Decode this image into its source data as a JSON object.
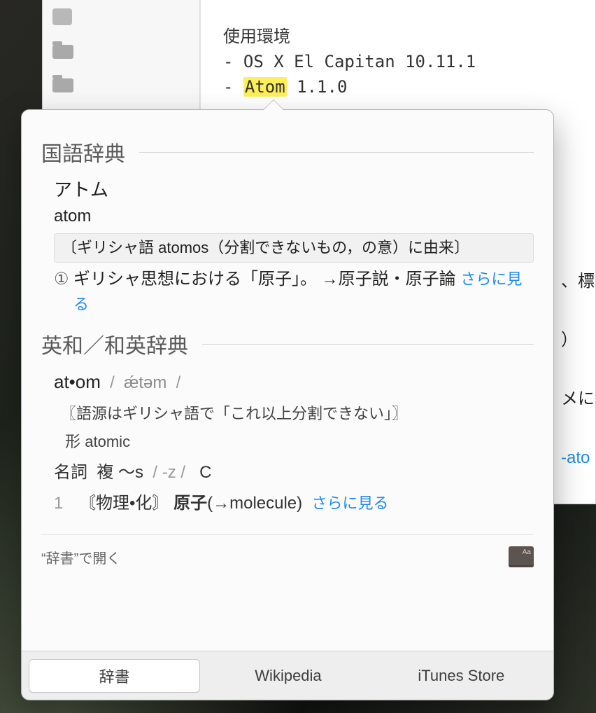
{
  "editor": {
    "heading": "使用環境",
    "line1_prefix": "- ",
    "line1_text": "OS X El Capitan 10.11.1",
    "line2_prefix": "- ",
    "highlighted_word": "Atom",
    "line2_suffix": " 1.1.0"
  },
  "popover": {
    "kokugo": {
      "title": "国語辞典",
      "term_kana": "アトム",
      "term_romaji": "atom",
      "etymology": "〔ギリシャ語 atomos（分割できないもの，の意）に由来〕",
      "sense_num": "①",
      "sense_text": "ギリシャ思想における「原子」。 →原子説・原子論",
      "see_more": "さらに見る"
    },
    "eiwa": {
      "title": "英和／和英辞典",
      "headword": "at•om",
      "pron": "ǽtəm",
      "etymology": "〖語源はギリシャ語で「これ以上分割できない」〗",
      "deriv_label": "形",
      "deriv_word": "atomic",
      "pos": "名詞",
      "plural_label": "複 〜s",
      "plural_pron": "-z",
      "count": "C",
      "sense_num": "1",
      "sense_field": "〘物理•化〙",
      "sense_bold": "原子",
      "sense_tail": "(→molecule)",
      "see_more": "さらに見る"
    },
    "open_label": "“辞書”で開く",
    "dict_icon_text": "Aa",
    "tabs": {
      "dict": "辞書",
      "wiki": "Wikipedia",
      "itunes": "iTunes Store"
    }
  },
  "right_peek": {
    "a": "、標",
    "b": "）",
    "c": "メに",
    "d": "-ato"
  }
}
